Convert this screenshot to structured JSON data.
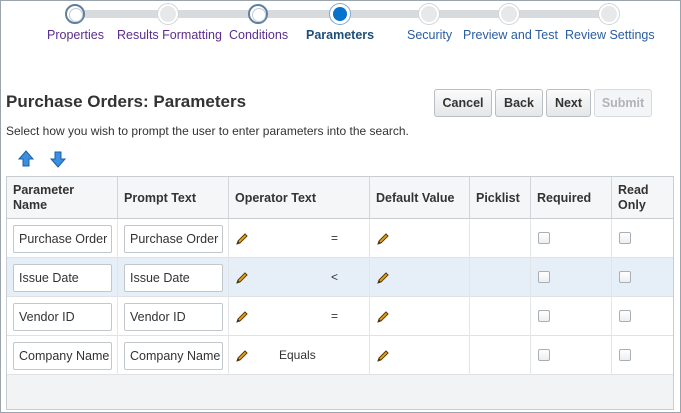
{
  "train": {
    "steps": [
      {
        "label": "Properties",
        "state": "visited"
      },
      {
        "label": "Results Formatting",
        "state": "visited"
      },
      {
        "label": "Conditions",
        "state": "visited"
      },
      {
        "label": "Parameters",
        "state": "current"
      },
      {
        "label": "Security",
        "state": "future"
      },
      {
        "label": "Preview and Test",
        "state": "future"
      },
      {
        "label": "Review Settings",
        "state": "future"
      }
    ]
  },
  "header": {
    "title": "Purchase Orders: Parameters",
    "buttons": {
      "cancel": "Cancel",
      "back": "Back",
      "next": "Next",
      "submit": "Submit"
    },
    "instructions": "Select how you wish to prompt the user to enter parameters into the search."
  },
  "toolbar": {
    "icons": [
      "move-up-icon",
      "move-down-icon"
    ]
  },
  "table": {
    "columns": {
      "parameter_name": "Parameter Name",
      "prompt_text": "Prompt Text",
      "operator_text": "Operator Text",
      "default_value": "Default Value",
      "picklist": "Picklist",
      "required": "Required",
      "read_only": "Read Only"
    },
    "rows": [
      {
        "parameter_name": "Purchase Order",
        "prompt_text": "Purchase Order",
        "operator": "=",
        "required": false,
        "read_only": false,
        "selected": false
      },
      {
        "parameter_name": "Issue Date",
        "prompt_text": "Issue Date",
        "operator": "<",
        "required": false,
        "read_only": false,
        "selected": true
      },
      {
        "parameter_name": "Vendor ID",
        "prompt_text": "Vendor ID",
        "operator": "=",
        "required": false,
        "read_only": false,
        "selected": false
      },
      {
        "parameter_name": "Company Name",
        "prompt_text": "Company Name",
        "operator": "Equals",
        "required": false,
        "read_only": false,
        "selected": false
      }
    ]
  },
  "colors": {
    "accent": "#0572ce",
    "visited_link": "#5b2e8c",
    "link": "#2a5d9f",
    "selected_row": "#e6eef7"
  }
}
